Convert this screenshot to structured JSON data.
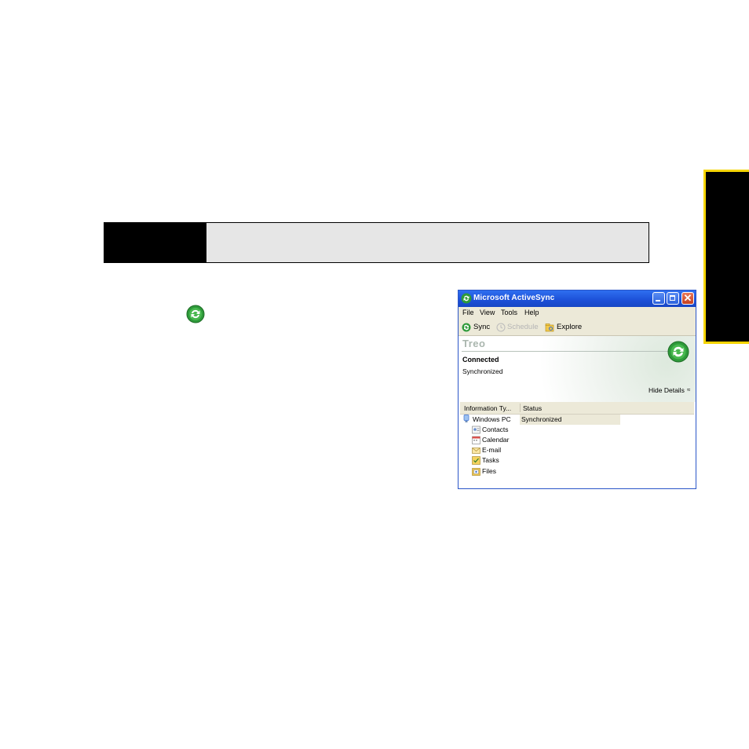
{
  "window": {
    "title": "Microsoft ActiveSync",
    "close_glyph": "✕",
    "menu": [
      "File",
      "View",
      "Tools",
      "Help"
    ],
    "toolbar": {
      "sync": "Sync",
      "schedule": "Schedule",
      "explore": "Explore"
    },
    "device_name": "Treo",
    "connection_status": "Connected",
    "sync_status": "Synchronized",
    "hide_details": "Hide Details",
    "hide_details_glyph": "≈",
    "columns": {
      "info_type": "Information Ty...",
      "status": "Status"
    },
    "rows": [
      {
        "name": "Windows PC",
        "status": "Synchronized",
        "icon": "computer-icon"
      },
      {
        "name": "Contacts",
        "status": "",
        "icon": "contacts-icon"
      },
      {
        "name": "Calendar",
        "status": "",
        "icon": "calendar-icon"
      },
      {
        "name": "E-mail",
        "status": "",
        "icon": "email-icon"
      },
      {
        "name": "Tasks",
        "status": "",
        "icon": "tasks-icon"
      },
      {
        "name": "Files",
        "status": "",
        "icon": "files-icon"
      }
    ]
  },
  "colors": {
    "accent_yellow": "#f5d400",
    "title_blue": "#1c4fd7",
    "sync_green": "#2e9a3a"
  }
}
